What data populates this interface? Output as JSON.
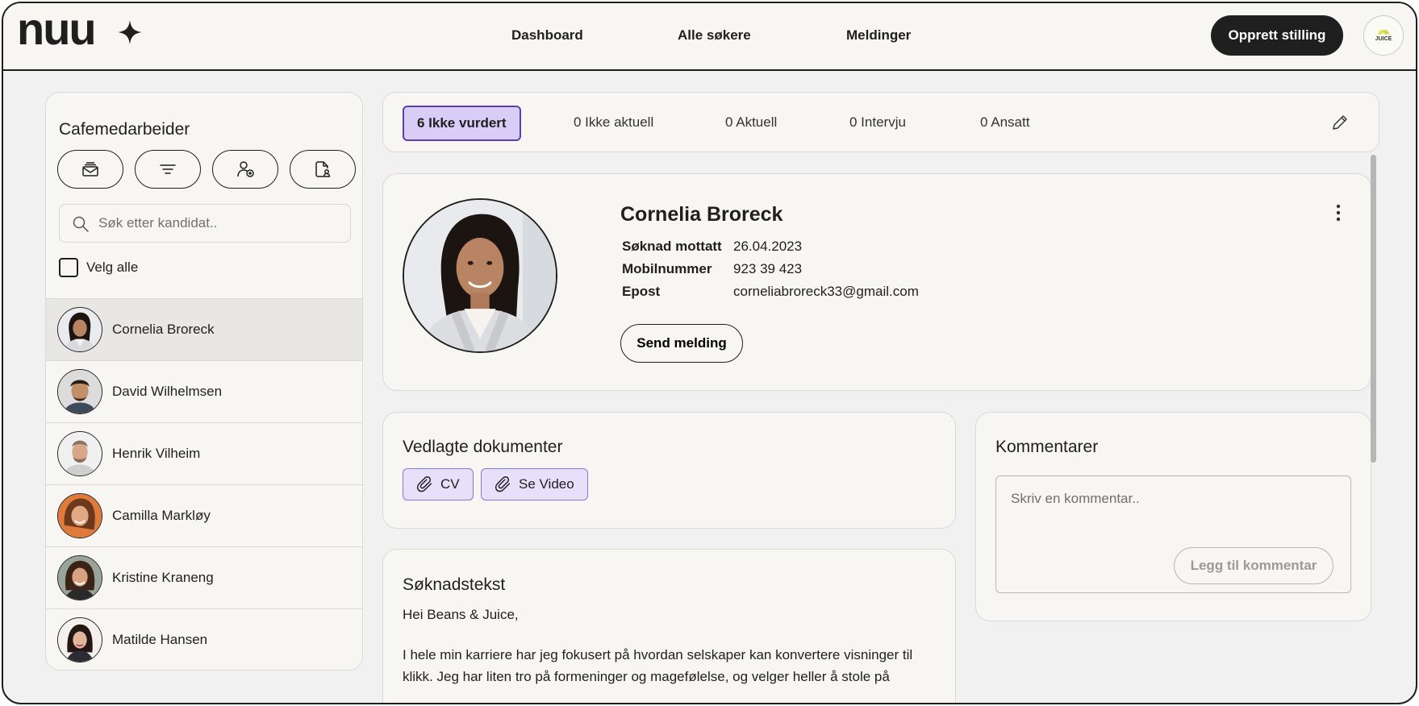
{
  "header": {
    "logo_text": "nuu",
    "nav": [
      "Dashboard",
      "Alle søkere",
      "Meldinger"
    ],
    "create_button": "Opprett stilling",
    "company_logo_text": "JUICE"
  },
  "sidebar": {
    "title": "Cafemedarbeider",
    "tool_icons": [
      "mail-stack-icon",
      "filter-icon",
      "add-user-icon",
      "document-user-icon"
    ],
    "search_placeholder": "Søk etter kandidat..",
    "select_all_label": "Velg alle",
    "candidates": [
      {
        "name": "Cornelia Broreck",
        "active": true
      },
      {
        "name": "David Wilhelmsen",
        "active": false
      },
      {
        "name": "Henrik Vilheim",
        "active": false
      },
      {
        "name": "Camilla Markløy",
        "active": false
      },
      {
        "name": "Kristine Kraneng",
        "active": false
      },
      {
        "name": "Matilde Hansen",
        "active": false
      }
    ]
  },
  "status_tabs": [
    {
      "label": "6 Ikke vurdert",
      "active": true
    },
    {
      "label": "0 Ikke aktuell",
      "active": false
    },
    {
      "label": "0 Aktuell",
      "active": false
    },
    {
      "label": "0 Intervju",
      "active": false
    },
    {
      "label": "0 Ansatt",
      "active": false
    }
  ],
  "profile": {
    "name": "Cornelia Broreck",
    "rows": [
      {
        "label": "Søknad mottatt",
        "value": "26.04.2023"
      },
      {
        "label": "Mobilnummer",
        "value": "923 39 423"
      },
      {
        "label": "Epost",
        "value": "corneliabroreck33@gmail.com"
      }
    ],
    "send_button": "Send melding"
  },
  "documents": {
    "title": "Vedlagte dokumenter",
    "items": [
      "CV",
      "Se Video"
    ]
  },
  "comments": {
    "title": "Kommentarer",
    "placeholder": "Skriv en kommentar..",
    "button": "Legg til kommentar"
  },
  "application": {
    "title": "Søknadstekst",
    "greeting": "Hei Beans & Juice,",
    "paragraph": "I hele min karriere har jeg fokusert på hvordan selskaper kan konvertere visninger til klikk. Jeg har liten tro på formeninger og magefølelse, og velger heller å stole på"
  }
}
